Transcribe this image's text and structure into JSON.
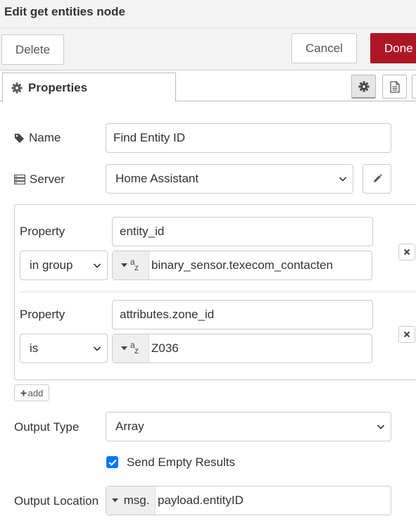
{
  "dialog": {
    "title": "Edit get entities node"
  },
  "toolbar": {
    "delete_label": "Delete",
    "cancel_label": "Cancel",
    "done_label": "Done"
  },
  "tabs": {
    "properties_label": "Properties"
  },
  "form": {
    "name_label": "Name",
    "name_value": "Find Entity ID",
    "server_label": "Server",
    "server_value": "Home Assistant",
    "conditions": [
      {
        "property_label": "Property",
        "property_value": "entity_id",
        "operator": "in group",
        "type_icon": "string-type-icon",
        "value": "binary_sensor.texecom_contacten"
      },
      {
        "property_label": "Property",
        "property_value": "attributes.zone_id",
        "operator": "is",
        "type_icon": "string-type-icon",
        "value": "Z036"
      }
    ],
    "add_label": "add",
    "output_type_label": "Output Type",
    "output_type_value": "Array",
    "send_empty_label": "Send Empty Results",
    "send_empty_checked": true,
    "output_location_label": "Output Location",
    "output_location_prefix": "msg.",
    "output_location_value": "payload.entityID"
  },
  "colors": {
    "done_button": "#ad1625",
    "checkbox": "#0075ff"
  }
}
